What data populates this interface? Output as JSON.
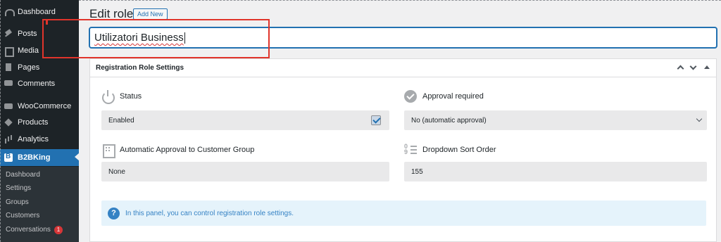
{
  "sidebar": {
    "items": [
      {
        "label": "Dashboard",
        "icon": "dashboard-icon"
      },
      {
        "label": "Posts",
        "icon": "pin-icon"
      },
      {
        "label": "Media",
        "icon": "media-icon"
      },
      {
        "label": "Pages",
        "icon": "pages-icon"
      },
      {
        "label": "Comments",
        "icon": "comment-icon"
      },
      {
        "label": "WooCommerce",
        "icon": "woocommerce-icon"
      },
      {
        "label": "Products",
        "icon": "box-icon"
      },
      {
        "label": "Analytics",
        "icon": "bar-chart-icon"
      },
      {
        "label": "B2BKing",
        "icon": "b2bking-icon"
      }
    ],
    "submenu": [
      {
        "label": "Dashboard"
      },
      {
        "label": "Settings"
      },
      {
        "label": "Groups"
      },
      {
        "label": "Customers"
      },
      {
        "label": "Conversations",
        "badge": "1"
      }
    ]
  },
  "header": {
    "title": "Edit role",
    "add_new_label": "Add New"
  },
  "role_name": "Utilizatori Business",
  "panel": {
    "title": "Registration Role Settings",
    "status": {
      "label": "Status",
      "value": "Enabled",
      "checked": true
    },
    "approval": {
      "label": "Approval required",
      "value": "No (automatic approval)"
    },
    "auto_group": {
      "label": "Automatic Approval to Customer Group",
      "value": "None"
    },
    "sort_order": {
      "label": "Dropdown Sort Order",
      "value": "155"
    },
    "info_text": "In this panel, you can control registration role settings."
  },
  "colors": {
    "accent": "#2271b1",
    "sidebar_bg": "#1d2327",
    "annotation_red": "#e0342b",
    "info_bg": "#e5f3fb"
  }
}
